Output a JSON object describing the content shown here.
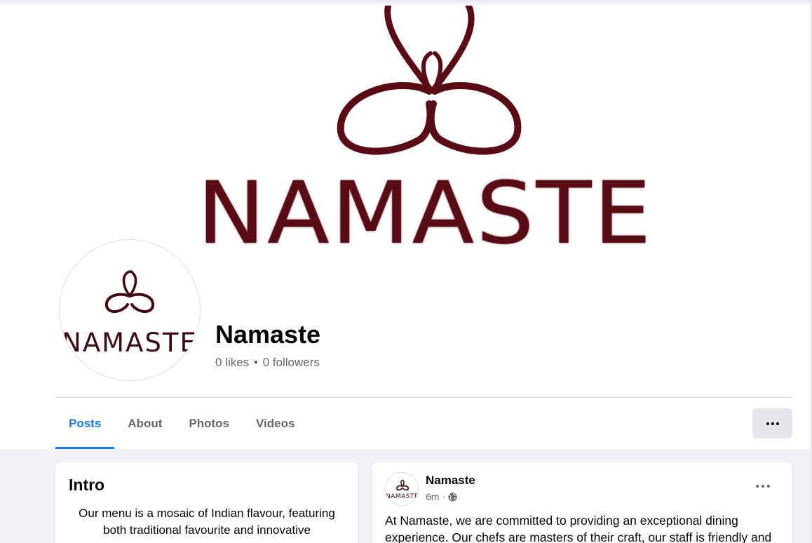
{
  "cover": {
    "brand_word": "NAMASTE",
    "logo_color": "#5a0c14"
  },
  "avatar": {
    "brand_word": "NAMASTE"
  },
  "page": {
    "name": "Namaste",
    "likes": "0 likes",
    "separator": "•",
    "followers": "0 followers"
  },
  "tabs": [
    {
      "label": "Posts",
      "active": true
    },
    {
      "label": "About",
      "active": false
    },
    {
      "label": "Photos",
      "active": false
    },
    {
      "label": "Videos",
      "active": false
    }
  ],
  "intro": {
    "title": "Intro",
    "text": "Our menu is a mosaic of Indian flavour, featuring both traditional favourite and innovative"
  },
  "post": {
    "author": "Namaste",
    "time": "6m",
    "dot": "·",
    "audience_icon": "globe-icon",
    "avatar_word": "NAMASTE",
    "text": "At Namaste, we are committed to providing an exceptional dining experience. Our chefs are masters of their craft, our staff is friendly and"
  },
  "colors": {
    "accent": "#1877f2",
    "secondary_text": "#65676b",
    "background": "#f0f2f5"
  }
}
